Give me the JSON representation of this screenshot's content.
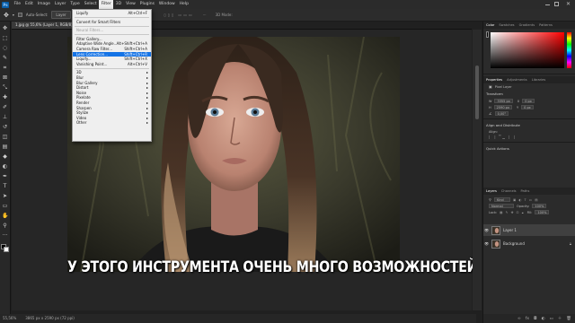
{
  "menubar": {
    "logo": "Ps",
    "items": [
      "File",
      "Edit",
      "Image",
      "Layer",
      "Type",
      "Select",
      "Filter",
      "3D",
      "View",
      "Plugins",
      "Window",
      "Help"
    ],
    "active_index": 6
  },
  "optbar": {
    "auto_select_label": "Auto-Select:",
    "auto_select_value": "Layer",
    "mode_3d": "3D Mode:"
  },
  "document": {
    "tab_title": "1.jpg @ 55,6% (Layer 1, RGB/8) *"
  },
  "status": {
    "zoom": "55,56%",
    "size": "3865 px x 2590 px (72 ppi)"
  },
  "filter_menu": {
    "items": [
      {
        "label": "Liquify",
        "shortcut": "Alt+Ctrl+F",
        "state": "normal"
      },
      {
        "sep": true
      },
      {
        "label": "Convert for Smart Filters",
        "shortcut": "",
        "state": "normal"
      },
      {
        "sep": true
      },
      {
        "label": "Neural Filters...",
        "shortcut": "",
        "state": "disabled"
      },
      {
        "sep": true
      },
      {
        "label": "Filter Gallery...",
        "shortcut": "",
        "state": "normal"
      },
      {
        "label": "Adaptive Wide Angle...",
        "shortcut": "Alt+Shift+Ctrl+A",
        "state": "normal"
      },
      {
        "label": "Camera Raw Filter...",
        "shortcut": "Shift+Ctrl+A",
        "state": "normal"
      },
      {
        "label": "Lens Correction...",
        "shortcut": "Shift+Ctrl+R",
        "state": "highlight"
      },
      {
        "label": "Liquify...",
        "shortcut": "Shift+Ctrl+X",
        "state": "normal"
      },
      {
        "label": "Vanishing Point...",
        "shortcut": "Alt+Ctrl+V",
        "state": "normal"
      },
      {
        "sep": true
      },
      {
        "label": "3D",
        "shortcut": "",
        "state": "submenu"
      },
      {
        "label": "Blur",
        "shortcut": "",
        "state": "submenu"
      },
      {
        "label": "Blur Gallery",
        "shortcut": "",
        "state": "submenu"
      },
      {
        "label": "Distort",
        "shortcut": "",
        "state": "submenu"
      },
      {
        "label": "Noise",
        "shortcut": "",
        "state": "submenu"
      },
      {
        "label": "Pixelate",
        "shortcut": "",
        "state": "submenu"
      },
      {
        "label": "Render",
        "shortcut": "",
        "state": "submenu"
      },
      {
        "label": "Sharpen",
        "shortcut": "",
        "state": "submenu"
      },
      {
        "label": "Stylize",
        "shortcut": "",
        "state": "submenu"
      },
      {
        "label": "Video",
        "shortcut": "",
        "state": "submenu"
      },
      {
        "label": "Other",
        "shortcut": "",
        "state": "submenu"
      }
    ]
  },
  "panels": {
    "color_tabs": [
      "Color",
      "Swatches",
      "Gradients",
      "Patterns"
    ],
    "properties_tabs": [
      "Properties",
      "Adjustments",
      "Libraries"
    ],
    "pixel_layer": "Pixel Layer",
    "transform_title": "Transform",
    "w_label": "W",
    "w_value": "3355 px",
    "h_label": "H",
    "h_value": "2590 px",
    "x_label": "X",
    "x_value": "0 px",
    "y_label": "Y",
    "y_value": "0 px",
    "angle_value": "0,00°",
    "align_title": "Align and Distribute",
    "align_sub": "Align:",
    "quick_actions": "Quick Actions",
    "layers_tabs": [
      "Layers",
      "Channels",
      "Paths"
    ],
    "kind_label": "Kind",
    "blend_mode": "Normal",
    "opacity_label": "Opacity:",
    "opacity_value": "100%",
    "lock_label": "Lock:",
    "fill_label": "Fill:",
    "fill_value": "100%",
    "layers": [
      {
        "name": "Layer 1",
        "selected": true
      },
      {
        "name": "Background",
        "selected": false
      }
    ]
  },
  "subtitle": "У ЭТОГО ИНСТРУМЕНТА ОЧЕНЬ МНОГО ВОЗМОЖНОСТЕЙ"
}
